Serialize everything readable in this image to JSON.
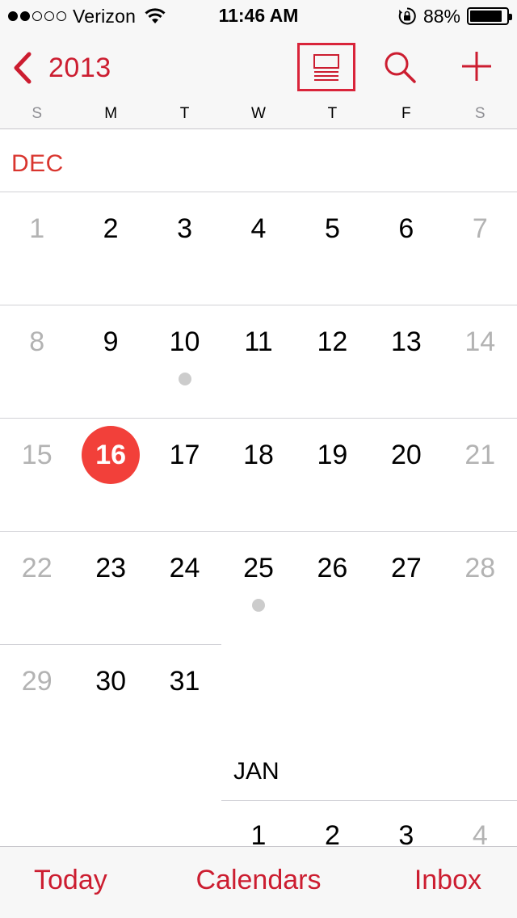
{
  "status_bar": {
    "carrier": "Verizon",
    "signal_bars_filled": 2,
    "signal_bars_total": 5,
    "time": "11:46 AM",
    "battery_percent_label": "88%",
    "battery_level": 0.88
  },
  "nav": {
    "back_label": "2013",
    "accent_color": "#cc1d30"
  },
  "weekdays": [
    "S",
    "M",
    "T",
    "W",
    "T",
    "F",
    "S"
  ],
  "months": {
    "dec": "DEC",
    "jan": "JAN"
  },
  "december": {
    "weeks": [
      [
        "1",
        "2",
        "3",
        "4",
        "5",
        "6",
        "7"
      ],
      [
        "8",
        "9",
        "10",
        "11",
        "12",
        "13",
        "14"
      ],
      [
        "15",
        "16",
        "17",
        "18",
        "19",
        "20",
        "21"
      ],
      [
        "22",
        "23",
        "24",
        "25",
        "26",
        "27",
        "28"
      ],
      [
        "29",
        "30",
        "31"
      ]
    ],
    "today": "16",
    "event_days": [
      "10",
      "25"
    ]
  },
  "january": {
    "first_week": [
      "1",
      "2",
      "3",
      "4"
    ]
  },
  "tabs": {
    "today": "Today",
    "calendars": "Calendars",
    "inbox": "Inbox"
  },
  "colors": {
    "today_circle": "#f2403a",
    "event_dot": "#cccccc",
    "weekend_text": "#b3b3b3"
  }
}
